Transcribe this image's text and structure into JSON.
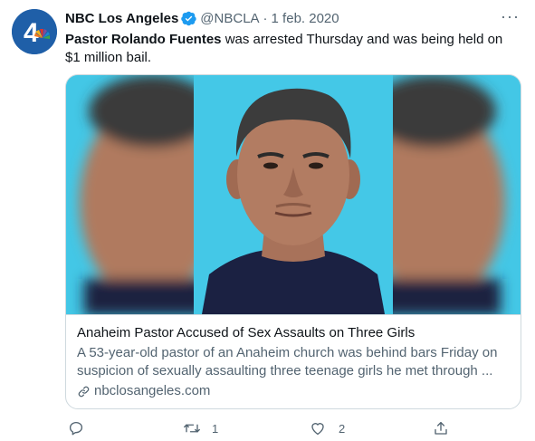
{
  "tweet": {
    "author_name": "NBC Los Angeles",
    "handle": "@NBCLA",
    "separator": "·",
    "date": "1 feb. 2020",
    "more_label": "···",
    "text_bold": "Pastor Rolando Fuentes",
    "text_rest": " was arrested Thursday and was being held on $1 million bail."
  },
  "card": {
    "title": "Anaheim Pastor Accused of Sex Assaults on Three Girls",
    "description": "A 53-year-old pastor of an Anaheim church was behind bars Friday on suspicion of sexually assaulting three teenage girls he met through ...",
    "domain": "nbclosangeles.com"
  },
  "actions": {
    "reply_count": "",
    "retweet_count": "1",
    "like_count": "2"
  },
  "colors": {
    "accent": "#1d9bf0",
    "text_primary": "#0f1419",
    "text_secondary": "#536471",
    "border": "#cfd9de",
    "photo_background": "#43c7e6"
  },
  "icons": [
    "nbc-peacock-avatar",
    "verified-badge-icon",
    "more-icon",
    "link-icon",
    "reply-icon",
    "retweet-icon",
    "like-icon",
    "share-icon"
  ]
}
